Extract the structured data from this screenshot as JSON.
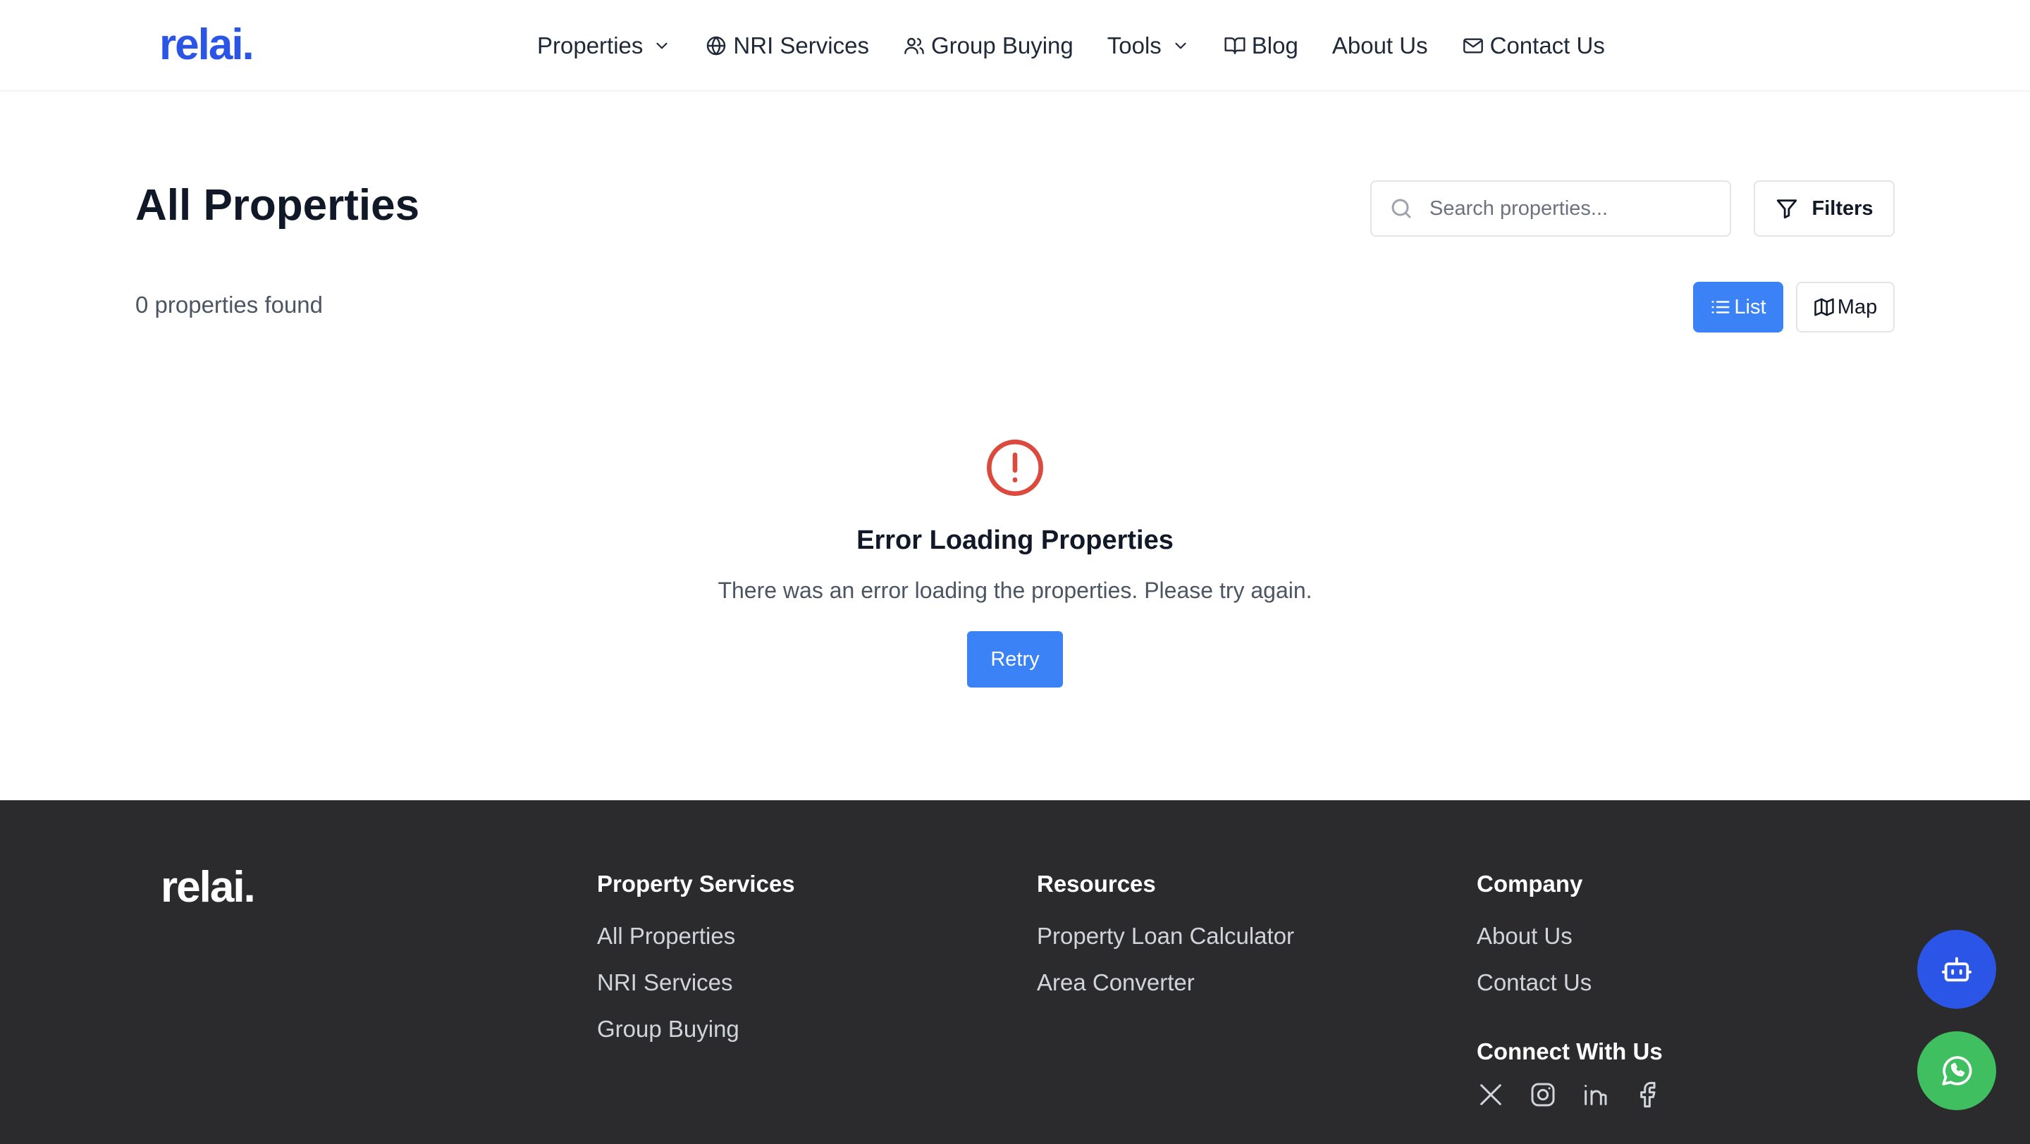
{
  "header": {
    "logo": "relai.",
    "nav": {
      "properties": "Properties",
      "nri_services": "NRI Services",
      "group_buying": "Group Buying",
      "tools": "Tools",
      "blog": "Blog",
      "about_us": "About Us",
      "contact_us": "Contact Us"
    }
  },
  "main": {
    "title": "All Properties",
    "search_placeholder": "Search properties...",
    "filters_label": "Filters",
    "count_text": "0 properties found",
    "view_toggle": {
      "list": "List",
      "map": "Map"
    },
    "error": {
      "title": "Error Loading Properties",
      "message": "There was an error loading the properties. Please try again.",
      "retry": "Retry"
    }
  },
  "footer": {
    "logo": "relai.",
    "property_services": {
      "title": "Property Services",
      "links": [
        "All Properties",
        "NRI Services",
        "Group Buying"
      ]
    },
    "resources": {
      "title": "Resources",
      "links": [
        "Property Loan Calculator",
        "Area Converter"
      ]
    },
    "company": {
      "title": "Company",
      "links": [
        "About Us",
        "Contact Us"
      ]
    },
    "connect_title": "Connect With Us",
    "socials": [
      "x-icon",
      "instagram-icon",
      "linkedin-icon",
      "facebook-icon"
    ]
  },
  "colors": {
    "brand": "#2b55e6",
    "primary_button": "#3b82f6",
    "error": "#dc4a3d",
    "footer_bg": "#2b2b2e",
    "whatsapp": "#3fbf5f"
  }
}
